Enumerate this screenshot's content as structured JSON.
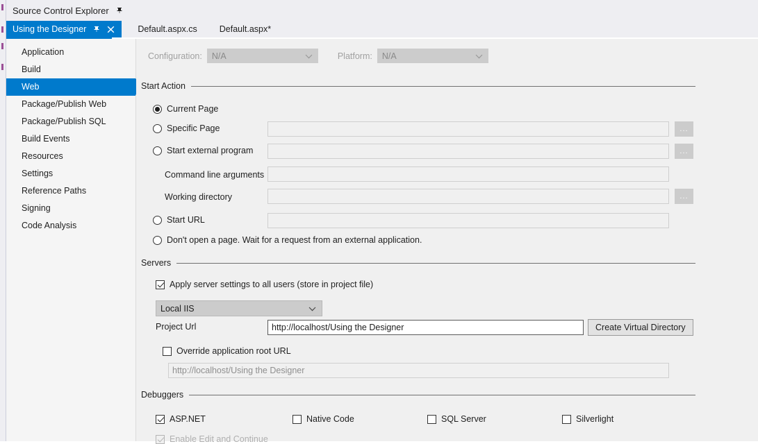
{
  "toolwindow": {
    "title": "Source Control Explorer",
    "pin_icon": "pin-icon"
  },
  "document_tabs": [
    {
      "label": "Using the Designer",
      "active": true,
      "pin_icon": "pin-icon",
      "close_icon": "close-icon"
    },
    {
      "label": "Default.aspx.cs",
      "active": false
    },
    {
      "label": "Default.aspx*",
      "active": false
    }
  ],
  "sidebar": {
    "items": [
      {
        "label": "Application",
        "selected": false
      },
      {
        "label": "Build",
        "selected": false
      },
      {
        "label": "Web",
        "selected": true
      },
      {
        "label": "Package/Publish Web",
        "selected": false
      },
      {
        "label": "Package/Publish SQL",
        "selected": false
      },
      {
        "label": "Build Events",
        "selected": false
      },
      {
        "label": "Resources",
        "selected": false
      },
      {
        "label": "Settings",
        "selected": false
      },
      {
        "label": "Reference Paths",
        "selected": false
      },
      {
        "label": "Signing",
        "selected": false
      },
      {
        "label": "Code Analysis",
        "selected": false
      }
    ]
  },
  "config_bar": {
    "configuration_label": "Configuration:",
    "configuration_value": "N/A",
    "platform_label": "Platform:",
    "platform_value": "N/A"
  },
  "start_action": {
    "title": "Start Action",
    "current_page": {
      "label": "Current Page",
      "checked": true
    },
    "specific_page": {
      "label": "Specific Page",
      "checked": false,
      "value": ""
    },
    "start_external_program": {
      "label": "Start external program",
      "checked": false,
      "value": ""
    },
    "command_line_arguments": {
      "label": "Command line arguments",
      "value": ""
    },
    "working_directory": {
      "label": "Working directory",
      "value": ""
    },
    "start_url": {
      "label": "Start URL",
      "checked": false,
      "value": ""
    },
    "dont_open_page": {
      "label": "Don't open a page.  Wait for a request from an external application.",
      "checked": false
    },
    "browse_button_label": "..."
  },
  "servers": {
    "title": "Servers",
    "apply_all_users": {
      "label": "Apply server settings to all users (store in project file)",
      "checked": true
    },
    "server_select": {
      "value": "Local IIS"
    },
    "project_url_label": "Project Url",
    "project_url_value": "http://localhost/Using the Designer",
    "create_virtual_directory_label": "Create Virtual Directory",
    "override_root_url": {
      "label": "Override application root URL",
      "checked": false
    },
    "override_root_url_value": "http://localhost/Using the Designer"
  },
  "debuggers": {
    "title": "Debuggers",
    "options": [
      {
        "label": "ASP.NET",
        "checked": true
      },
      {
        "label": "Native Code",
        "checked": false
      },
      {
        "label": "SQL Server",
        "checked": false
      },
      {
        "label": "Silverlight",
        "checked": false
      }
    ],
    "enable_edit_and_continue": {
      "label": "Enable Edit and Continue",
      "checked": true
    }
  },
  "colors": {
    "accent": "#007acc",
    "panel": "#f0f0f0",
    "sidebar": "#f5f5f5"
  }
}
